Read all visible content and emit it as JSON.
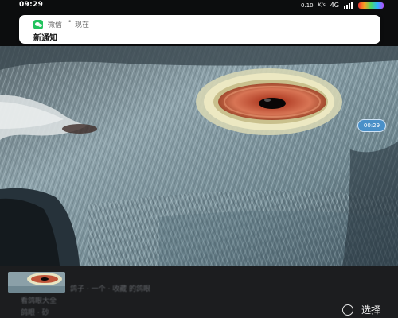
{
  "status_bar": {
    "time": "09:29",
    "right_text_1": "0.10",
    "right_text_2": "K/s",
    "network": "4G",
    "battery_label": "100"
  },
  "notification": {
    "app": "微信",
    "separator": "•",
    "time": "现在",
    "body": "新通知",
    "icon": "wechat-icon",
    "accent": "#22c35e"
  },
  "photo": {
    "timestamp": "00:29"
  },
  "chat_preview": {
    "line1": "鸽子 · 一个 · 收藏 的鸽眼",
    "line2": "看鸽眼大全",
    "line3": "鸽眼 · 砂"
  },
  "footer": {
    "select_label": "选择"
  }
}
